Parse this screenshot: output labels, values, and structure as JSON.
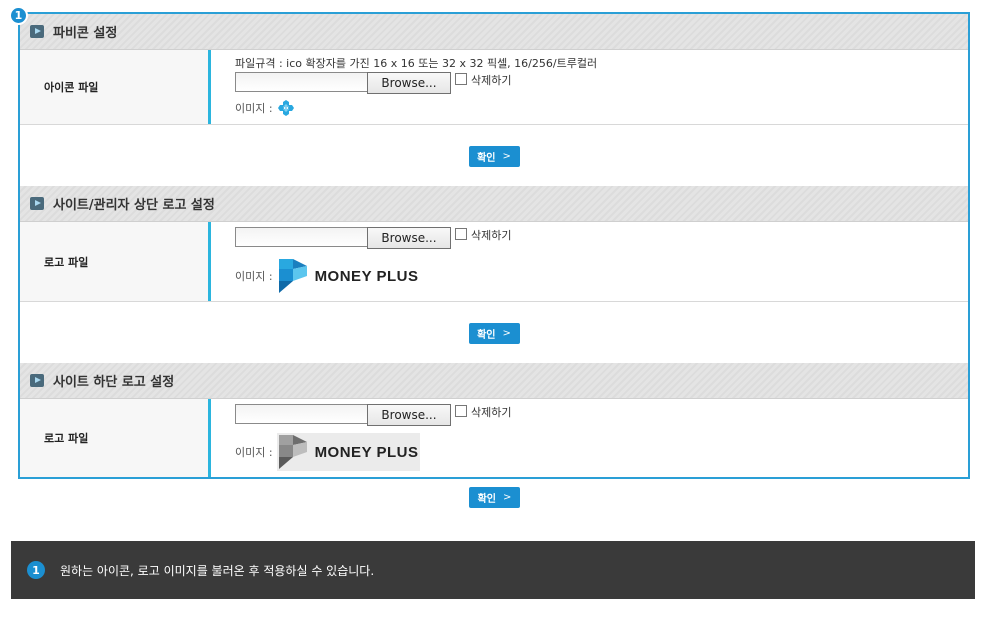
{
  "badge": "1",
  "sections": [
    {
      "title": "파비콘 설정",
      "row_label": "아이콘 파일",
      "spec": "파일규격 : ico 확장자를 가진 16 x 16 또는 32 x 32 픽셀, 16/256/트루컬러",
      "browse": "Browse...",
      "delete": "삭제하기",
      "image_label": "이미지 :"
    },
    {
      "title": "사이트/관리자 상단 로고 설정",
      "row_label": "로고 파일",
      "browse": "Browse...",
      "delete": "삭제하기",
      "image_label": "이미지 :",
      "logo_text": "MONEY PLUS"
    },
    {
      "title": "사이트 하단 로고 설정",
      "row_label": "로고 파일",
      "browse": "Browse...",
      "delete": "삭제하기",
      "image_label": "이미지 :",
      "logo_text": "MONEY PLUS"
    }
  ],
  "confirm_label": "확인",
  "confirm_chevron": ">",
  "info": {
    "badge": "1",
    "text": "원하는 아이콘, 로고 이미지를 불러온 후 적용하실 수 있습니다."
  },
  "colors": {
    "accent": "#1b8fd1",
    "frame_border": "#2a9fd6",
    "label_divider": "#2bb5de",
    "info_bar": "#3a3a3a",
    "logo_blue": "#29a8e0",
    "logo_gray": "#888888"
  }
}
